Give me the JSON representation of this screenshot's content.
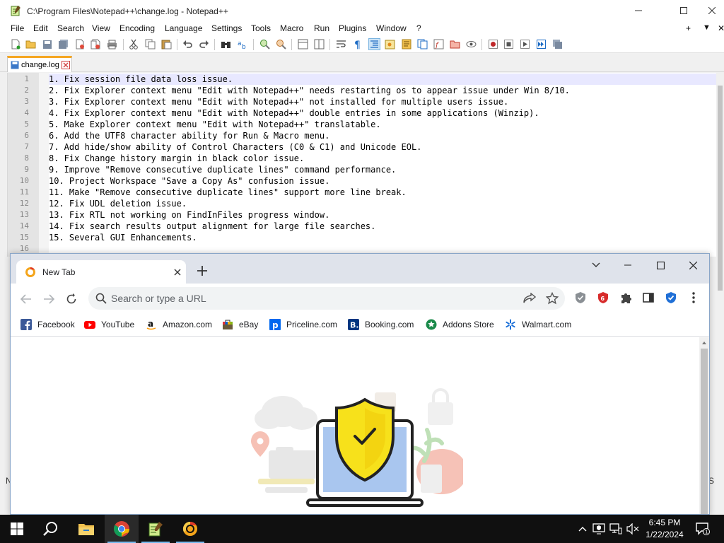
{
  "notepadpp": {
    "title": "C:\\Program Files\\Notepad++\\change.log - Notepad++",
    "menu": [
      "File",
      "Edit",
      "Search",
      "View",
      "Encoding",
      "Language",
      "Settings",
      "Tools",
      "Macro",
      "Run",
      "Plugins",
      "Window",
      "?"
    ],
    "menu_right": [
      "+",
      "▼",
      "✕"
    ],
    "tab": {
      "label": "change.log"
    },
    "lines": [
      {
        "num": "1",
        "text": "1. Fix session file data loss issue."
      },
      {
        "num": "2",
        "text": "2. Fix Explorer context menu \"Edit with Notepad++\" needs restarting os to appear issue under Win 8/10."
      },
      {
        "num": "3",
        "text": "3. Fix Explorer context menu \"Edit with Notepad++\" not installed for multiple users issue."
      },
      {
        "num": "4",
        "text": "4. Fix Explorer context menu \"Edit with Notepad++\" double entries in some applications (Winzip)."
      },
      {
        "num": "5",
        "text": "5. Make Explorer context menu \"Edit with Notepad++\" translatable."
      },
      {
        "num": "6",
        "text": "6. Add the UTF8 character ability for Run & Macro menu."
      },
      {
        "num": "7",
        "text": "7. Add hide/show ability of Control Characters (C0 & C1) and Unicode EOL."
      },
      {
        "num": "8",
        "text": "8. Fix Change history margin in black color issue."
      },
      {
        "num": "9",
        "text": "9. Improve \"Remove consecutive duplicate lines\" command performance."
      },
      {
        "num": "10",
        "text": "10. Project Workspace \"Save a Copy As\" confusion issue."
      },
      {
        "num": "11",
        "text": "11. Make \"Remove consecutive duplicate lines\" support more line break."
      },
      {
        "num": "12",
        "text": "12. Fix UDL deletion issue."
      },
      {
        "num": "13",
        "text": "13. Fix RTL not working on FindInFiles progress window."
      },
      {
        "num": "14",
        "text": "14. Fix search results output alignment for large file searches."
      },
      {
        "num": "15",
        "text": "15. Several GUI Enhancements."
      },
      {
        "num": "16",
        "text": ""
      }
    ],
    "status_left": "N",
    "status_right": "S"
  },
  "chrome": {
    "tab_title": "New Tab",
    "omnibox_placeholder": "Search or type a URL",
    "bookmarks": [
      {
        "label": "Facebook",
        "icon": "facebook-icon"
      },
      {
        "label": "YouTube",
        "icon": "youtube-icon"
      },
      {
        "label": "Amazon.com",
        "icon": "amazon-icon"
      },
      {
        "label": "eBay",
        "icon": "ebay-icon"
      },
      {
        "label": "Priceline.com",
        "icon": "priceline-icon"
      },
      {
        "label": "Booking.com",
        "icon": "booking-icon"
      },
      {
        "label": "Addons Store",
        "icon": "addons-store-icon"
      },
      {
        "label": "Walmart.com",
        "icon": "walmart-icon"
      }
    ]
  },
  "taskbar": {
    "time": "6:45 PM",
    "date": "1/22/2024",
    "notification_count": "1"
  },
  "colors": {
    "npp_tab_accent": "#f5a623",
    "current_line": "#e8e8ff",
    "chrome_frame": "#dfe3eb",
    "taskbar": "#101010",
    "shield_yellow": "#f7e11b",
    "facebook_blue": "#3b5998",
    "youtube_red": "#ff0000"
  }
}
